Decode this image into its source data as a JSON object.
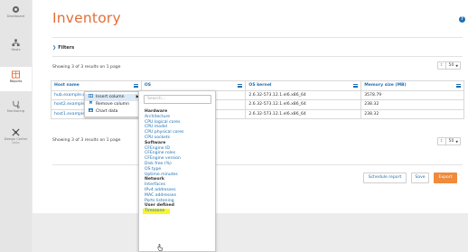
{
  "nav": [
    {
      "label": "Dashboard",
      "icon": "dashboard-icon"
    },
    {
      "label": "Hosts",
      "icon": "hosts-icon"
    },
    {
      "label": "Reports",
      "icon": "reports-icon"
    },
    {
      "label": "Monitoring",
      "icon": "monitoring-icon"
    },
    {
      "label": "Design Center",
      "sublabel": "beta",
      "icon": "design-center-icon"
    }
  ],
  "page": {
    "title": "Inventory",
    "help_icon": "help-icon"
  },
  "filters": {
    "label": "Filters"
  },
  "results_text": "Showing 3 of 3 results on 1 page",
  "page_size": "50",
  "table": {
    "columns": [
      "Host name",
      "OS",
      "OS kernel",
      "Memory size (MB)"
    ],
    "rows": [
      [
        "hub.example.com",
        "",
        "2.6.32-573.12.1.el6.x86_64",
        "3578.79"
      ],
      [
        "host2.example.com",
        "",
        "2.6.32-573.12.1.el6.x86_64",
        "238.32"
      ],
      [
        "host1.example.com",
        "",
        "2.6.32-573.12.1.el6.x86_64",
        "238.32"
      ]
    ]
  },
  "context_menu": {
    "items": [
      "Insert column",
      "Remove column",
      "Chart data"
    ]
  },
  "column_menu": {
    "search_placeholder": "Search...",
    "groups": [
      {
        "name": "Hardware",
        "options": [
          "Architecture",
          "CPU logical cores",
          "CPU model",
          "CPU physical cores",
          "CPU sockets"
        ]
      },
      {
        "name": "Software",
        "options": [
          "CFEngine ID",
          "CFEngine roles",
          "CFEngine version",
          "Disk free (%)",
          "OS type",
          "Uptime minutes"
        ]
      },
      {
        "name": "Network",
        "options": [
          "Interfaces",
          "IPv4 addresses",
          "MAC addresses",
          "Ports listening"
        ]
      },
      {
        "name": "User defined",
        "options": [
          "Timezone"
        ]
      }
    ],
    "highlighted": "Timezone"
  },
  "actions": {
    "schedule": "Schedule report",
    "save": "Save",
    "export": "Export"
  },
  "colors": {
    "accent": "#e36e36",
    "link": "#1f6fb2",
    "export": "#f08a3c",
    "highlight": "#f8f52a"
  }
}
